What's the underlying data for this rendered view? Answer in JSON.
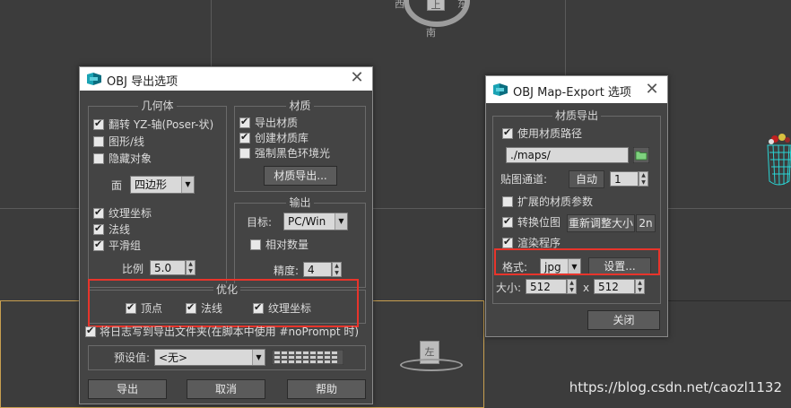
{
  "obj_export_dialog": {
    "title": "OBJ 导出选项",
    "geometry": {
      "title": "几何体",
      "flip_yz": {
        "label": "翻转 YZ-轴(Poser-状)",
        "checked": true
      },
      "shapes_lines": {
        "label": "图形/线",
        "checked": false
      },
      "hidden_objects": {
        "label": "隐藏对象",
        "checked": false
      },
      "faces_label": "面",
      "faces_value": "四边形",
      "texture_coords": {
        "label": "纹理坐标",
        "checked": true
      },
      "normals": {
        "label": "法线",
        "checked": true
      },
      "smoothing_groups": {
        "label": "平滑组",
        "checked": true
      },
      "scale_label": "比例",
      "scale_value": "5.0"
    },
    "material": {
      "title": "材质",
      "export_materials": {
        "label": "导出材质",
        "checked": true
      },
      "create_mat_library": {
        "label": "创建材质库",
        "checked": true
      },
      "force_black_ambient": {
        "label": "强制黑色环境光",
        "checked": false
      },
      "material_export_button": "材质导出..."
    },
    "output": {
      "title": "输出",
      "target_label": "目标:",
      "target_value": "PC/Win",
      "relative_numbers": {
        "label": "相对数量",
        "checked": false
      },
      "precision_label": "精度:",
      "precision_value": "4"
    },
    "optimize": {
      "title": "优化",
      "vertices": {
        "label": "顶点",
        "checked": true
      },
      "normals": {
        "label": "法线",
        "checked": true
      },
      "texture_coords": {
        "label": "纹理坐标",
        "checked": true
      }
    },
    "log_to_folder": {
      "label": "将日志写到导出文件夹(在脚本中使用 #noPrompt 时)",
      "checked": true
    },
    "preset_label": "预设值:",
    "preset_value": "<无>",
    "buttons": {
      "export": "导出",
      "cancel": "取消",
      "help": "帮助"
    }
  },
  "map_export_dialog": {
    "title": "OBJ Map-Export 选项",
    "group_title": "材质导出",
    "use_material_path": {
      "label": "使用材质路径",
      "checked": true
    },
    "path_value": "./maps/",
    "channel_label": "贴图通道:",
    "channel_auto": "自动",
    "channel_value": "1",
    "extended_params": {
      "label": "扩展的材质参数",
      "checked": false
    },
    "convert_bitmaps": {
      "label": "转换位图",
      "checked": true
    },
    "resize_button": "重新调整大小",
    "pow2_button": "2n",
    "render_procedurals": {
      "label": "渲染程序",
      "checked": true
    },
    "format_label": "格式:",
    "format_value": "jpg",
    "settings_button": "设置...",
    "size_label": "大小:",
    "width_value": "512",
    "x_label": "x",
    "height_value": "512",
    "close_button": "关闭"
  },
  "viewport": {
    "top_cube_label": "上",
    "top_cube_south": "南",
    "left_cube_label": "左"
  },
  "watermark": "https://blog.csdn.net/caozl1132",
  "colors": {
    "accent_red": "#e8342b",
    "dialog_bg": "#444444",
    "viewport_bg": "#3c3c3c"
  }
}
